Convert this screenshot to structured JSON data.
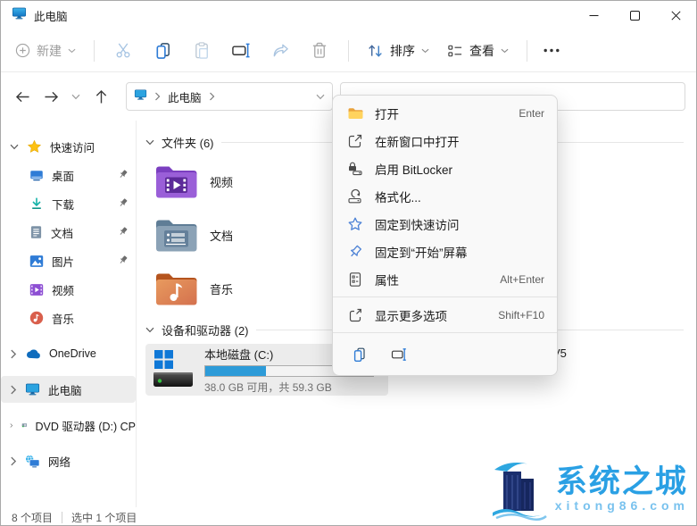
{
  "window": {
    "title": "此电脑"
  },
  "toolbar": {
    "new_label": "新建",
    "sort_label": "排序",
    "view_label": "查看",
    "icons": [
      "plus-new-icon",
      "cut-icon",
      "copy-icon",
      "paste-icon",
      "rename-icon",
      "share-icon",
      "delete-icon",
      "sort-icon",
      "view-icon",
      "more-options-icon"
    ]
  },
  "navbar": {
    "path_root": "此电脑"
  },
  "search": {
    "value": "",
    "placeholder": ""
  },
  "sidebar": {
    "quick_access": {
      "label": "快速访问"
    },
    "quick_items": [
      {
        "label": "桌面",
        "icon": "desktop-icon",
        "pinned": true
      },
      {
        "label": "下载",
        "icon": "download-icon",
        "pinned": true
      },
      {
        "label": "文档",
        "icon": "document-icon",
        "pinned": true
      },
      {
        "label": "图片",
        "icon": "pictures-icon",
        "pinned": true
      },
      {
        "label": "视频",
        "icon": "video-icon",
        "pinned": false
      },
      {
        "label": "音乐",
        "icon": "music-icon",
        "pinned": false
      }
    ],
    "tree_items": [
      {
        "label": "OneDrive",
        "icon": "onedrive-icon",
        "selected": false
      },
      {
        "label": "此电脑",
        "icon": "computer-icon",
        "selected": true
      },
      {
        "label": "DVD 驱动器 (D:) CP",
        "icon": "dvd-icon",
        "selected": false
      },
      {
        "label": "网络",
        "icon": "network-icon",
        "selected": false
      }
    ]
  },
  "content": {
    "folders": {
      "title": "文件夹 (6)",
      "items": [
        {
          "name": "视频"
        },
        {
          "name": "文档"
        },
        {
          "name": "音乐"
        }
      ]
    },
    "devices": {
      "title": "设备和驱动器 (2)",
      "drive": {
        "name": "本地磁盘 (C:)",
        "usage": "38.0 GB 可用，共 59.3 GB",
        "used_percent": 36
      },
      "clipped_fragment": "V5"
    }
  },
  "context_menu": {
    "items": [
      {
        "label": "打开",
        "shortcut": "Enter",
        "icon": "folder-icon"
      },
      {
        "label": "在新窗口中打开",
        "shortcut": "",
        "icon": "open-new-window-icon"
      },
      {
        "label": "启用 BitLocker",
        "shortcut": "",
        "icon": "bitlocker-lock-icon"
      },
      {
        "label": "格式化...",
        "shortcut": "",
        "icon": "format-drive-icon"
      },
      {
        "label": "固定到快速访问",
        "shortcut": "",
        "icon": "star-outline-icon"
      },
      {
        "label": "固定到“开始”屏幕",
        "shortcut": "",
        "icon": "pin-outline-icon"
      },
      {
        "label": "属性",
        "shortcut": "Alt+Enter",
        "icon": "properties-icon"
      },
      {
        "label": "显示更多选项",
        "shortcut": "Shift+F10",
        "icon": "show-more-icon"
      }
    ],
    "quick_icons": [
      "copy-icon",
      "rename-icon"
    ]
  },
  "status_bar": {
    "count": "8 个项目",
    "selected": "选中 1 个项目"
  },
  "watermark": {
    "name": "系统之城",
    "domain": "xitong86.com"
  },
  "colors": {
    "accent": "#0078d4",
    "progress_fill": "#2d9bd8",
    "selection": "#ededed",
    "star_gold": "#fdc112",
    "menu_blue": "#4d82d6",
    "folder_yellow": "#ffd35e"
  }
}
